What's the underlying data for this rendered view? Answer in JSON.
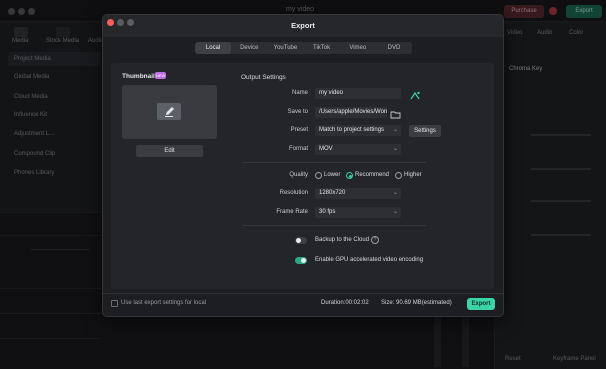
{
  "background": {
    "window_title": "my video",
    "purchase_label": "Purchase",
    "export_label": "Export",
    "top_tabs": [
      "Media",
      "Stock Media",
      "Audio"
    ],
    "sidebar_items": [
      "Project Media",
      "Global Media",
      "Cloud Media",
      "Influence Kit",
      "Adjustment L...",
      "Compound Clip",
      "Phones Library"
    ],
    "right_tabs": [
      "Video",
      "Audio",
      "Color"
    ],
    "right_items": [
      "Chroma Key",
      "Reset",
      "Keyframe Panel"
    ],
    "colors": {
      "purchase": "#5a2b30",
      "export": "#1d6e58"
    }
  },
  "dialog": {
    "title": "Export",
    "tabs": [
      "Local",
      "Device",
      "YouTube",
      "TikTok",
      "Vimeo",
      "DVD"
    ],
    "active_tab": "Local",
    "thumbnail": {
      "label": "Thumbnail:",
      "badge": "NEW",
      "edit_label": "Edit",
      "icon": "pencil-icon"
    },
    "output_settings": {
      "label": "Output Settings",
      "name_label": "Name",
      "name_value": "my video",
      "ai_icon": "ai-rename-icon",
      "save_to_label": "Save to",
      "save_to_value": "/Users/apple/Movies/Won",
      "folder_icon": "folder-icon",
      "preset_label": "Preset",
      "preset_value": "Match to project settings",
      "settings_label": "Settings",
      "format_label": "Format",
      "format_value": "MOV",
      "quality_label": "Quality",
      "quality_options": [
        "Lower",
        "Recommend",
        "Higher"
      ],
      "quality_selected": "Recommend",
      "resolution_label": "Resolution",
      "resolution_value": "1280x720",
      "frame_rate_label": "Frame Rate",
      "frame_rate_value": "30 fps",
      "backup_label": "Backup to the Cloud",
      "backup_on": false,
      "gpu_label": "Enable GPU accelerated video encoding",
      "gpu_on": true
    },
    "footer": {
      "remember_label": "Use last export settings for local",
      "duration_label": "Duration:00:02:02",
      "size_label": "Size: 90.69 MB(estimated)",
      "export_label": "Export"
    },
    "colors": {
      "accent": "#3ad4a7",
      "toggle_on": "#2aa886"
    }
  }
}
